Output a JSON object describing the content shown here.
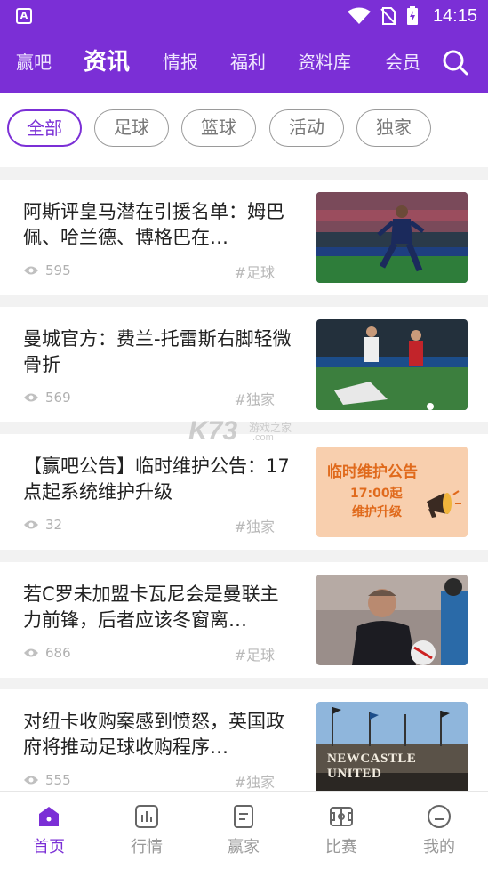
{
  "status_bar": {
    "time": "14:15"
  },
  "top_nav": {
    "items": [
      {
        "label": "赢吧",
        "active": false
      },
      {
        "label": "资讯",
        "active": true
      },
      {
        "label": "情报",
        "active": false
      },
      {
        "label": "福利",
        "active": false
      },
      {
        "label": "资料库",
        "active": false
      },
      {
        "label": "会员",
        "active": false
      }
    ],
    "search_icon": "search-icon"
  },
  "filters": [
    {
      "label": "全部",
      "active": true
    },
    {
      "label": "足球",
      "active": false
    },
    {
      "label": "篮球",
      "active": false
    },
    {
      "label": "活动",
      "active": false
    },
    {
      "label": "独家",
      "active": false
    }
  ],
  "news": [
    {
      "title": "阿斯评皇马潜在引援名单：姆巴佩、哈兰德、博格巴在…",
      "views": "595",
      "tag": "#足球",
      "thumb": "soccer-player-photo"
    },
    {
      "title": "曼城官方：费兰-托雷斯右脚轻微骨折",
      "views": "569",
      "tag": "#独家",
      "thumb": "soccer-match-photo"
    },
    {
      "title": "【赢吧公告】临时维护公告：17点起系统维护升级",
      "views": "32",
      "tag": "#独家",
      "thumb": "maintenance-notice-banner"
    },
    {
      "title": "若C罗未加盟卡瓦尼会是曼联主力前锋，后者应该冬窗离…",
      "views": "686",
      "tag": "#足球",
      "thumb": "coach-photo"
    },
    {
      "title": "对纽卡收购案感到愤怒，英国政府将推动足球收购程序…",
      "views": "555",
      "tag": "#独家",
      "thumb": "stadium-sign-photo"
    }
  ],
  "banner_text": {
    "line1": "临时维护公告",
    "line2": "17:00起",
    "line3": "维护升级"
  },
  "stadium_sign_text": "NEWCASTLE UNITED",
  "watermark": {
    "text": "K73",
    "sub1": "游戏之家",
    "sub2": ".com"
  },
  "bottom_nav": [
    {
      "label": "首页",
      "icon": "home-icon",
      "active": true
    },
    {
      "label": "行情",
      "icon": "chart-icon",
      "active": false
    },
    {
      "label": "赢家",
      "icon": "document-icon",
      "active": false
    },
    {
      "label": "比赛",
      "icon": "field-icon",
      "active": false
    },
    {
      "label": "我的",
      "icon": "profile-icon",
      "active": false
    }
  ],
  "colors": {
    "accent": "#7b2fd6",
    "banner_bg": "#f8cfae",
    "banner_text": "#e06a1c"
  }
}
